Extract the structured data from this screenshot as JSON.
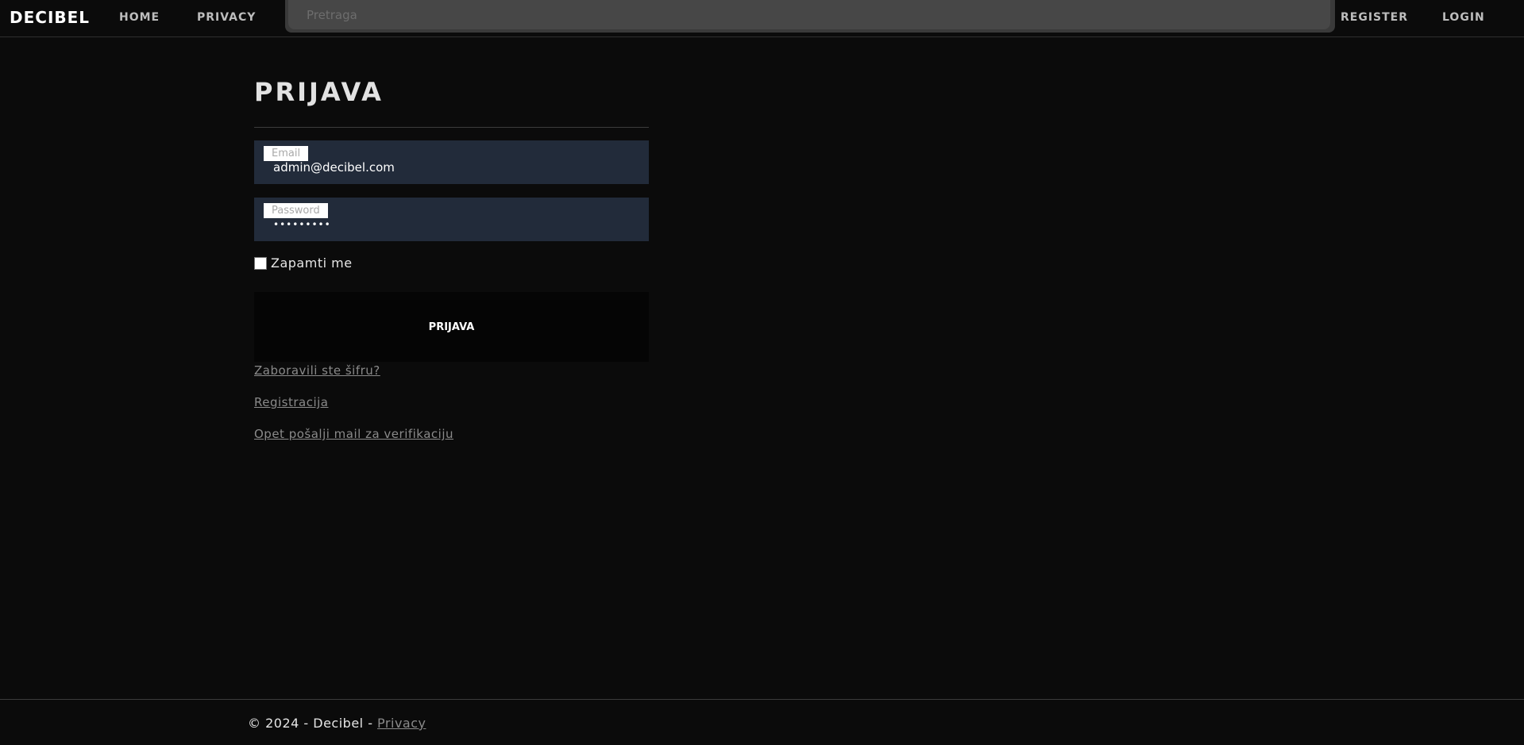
{
  "navbar": {
    "brand": "DECIBEL",
    "links": {
      "home": "HOME",
      "privacy": "PRIVACY",
      "register": "REGISTER",
      "login": "LOGIN"
    },
    "search": {
      "placeholder": "Pretraga",
      "value": ""
    }
  },
  "login_form": {
    "title": "PRIJAVA",
    "email": {
      "label": "Email",
      "value": "admin@decibel.com"
    },
    "password": {
      "label": "Password",
      "value": "•••••••••"
    },
    "remember_label": "Zapamti me",
    "remember_checked": false,
    "submit_label": "PRIJAVA",
    "links": {
      "forgot_password": "Zaboravili ste šifru?",
      "register": "Registracija",
      "resend_verification": "Opet pošalji mail za verifikaciju"
    }
  },
  "footer": {
    "copyright": "© 2024 - Decibel - ",
    "privacy_link": "Privacy"
  },
  "colors": {
    "background": "#0b0b0b",
    "field_background": "#222b3a",
    "search_background": "#474747",
    "link_muted": "#8a8a8a"
  }
}
